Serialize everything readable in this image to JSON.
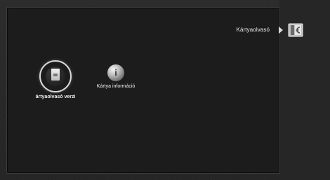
{
  "header": {
    "section_title": "Kártyaolvasó",
    "section_icon": "card-reader-icon"
  },
  "menu": {
    "items": [
      {
        "label": "ártyaolvasó verzi",
        "icon": "card-icon",
        "selected": true
      },
      {
        "label": "Kártya információ",
        "icon": "info-icon",
        "selected": false
      }
    ]
  },
  "colors": {
    "panel_bg": "#1c1c1c",
    "background": "#2a2a2a",
    "text": "#f2f2f2"
  }
}
